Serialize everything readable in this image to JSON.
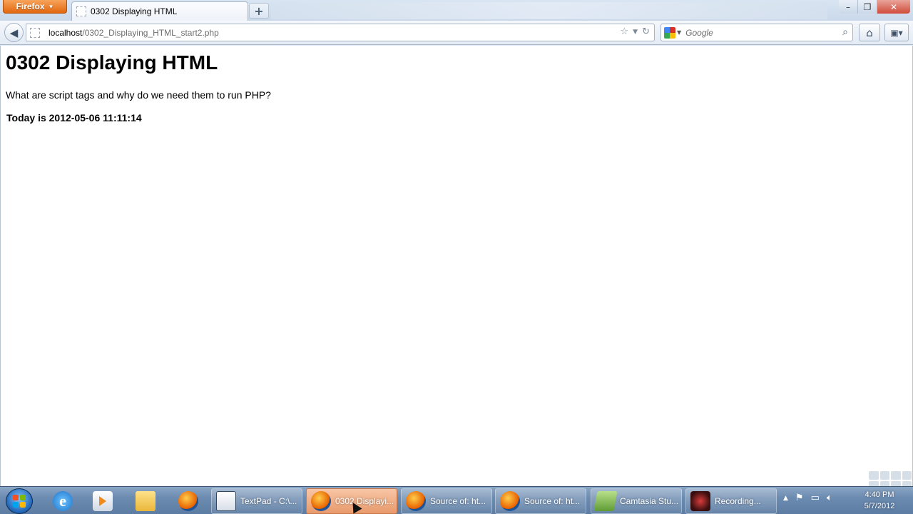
{
  "browser": {
    "menu_label": "Firefox",
    "tab": {
      "title": "0302 Displaying HTML"
    },
    "new_tab_label": "+",
    "window_controls": {
      "minimize": "–",
      "maximize": "❐",
      "close": "✕"
    },
    "url": {
      "host": "localhost",
      "path": "/0302_Displaying_HTML_start2.php"
    },
    "search": {
      "placeholder": "Google",
      "value": ""
    },
    "icons": [
      "back-arrow-icon",
      "bookmark-star-icon",
      "history-dropdown-icon",
      "reload-icon",
      "search-icon",
      "home-icon",
      "addon-icon"
    ]
  },
  "page": {
    "heading": "0302 Displaying HTML",
    "paragraph": "What are script tags and why do we need them to run PHP?",
    "date_line": "Today is 2012-05-06 11:11:14"
  },
  "taskbar": {
    "pinned": [
      "Internet Explorer",
      "Windows Media Player",
      "Windows Explorer",
      "Firefox"
    ],
    "tasks": [
      {
        "label": "TextPad - C:\\...",
        "active": false
      },
      {
        "label": "0302 Displayi...",
        "active": true
      },
      {
        "label": "Source of: ht...",
        "active": false
      },
      {
        "label": "Source of: ht...",
        "active": false
      },
      {
        "label": "Camtasia Stu...",
        "active": false
      },
      {
        "label": "Recording...",
        "active": false
      }
    ],
    "clock": {
      "time": "4:40 PM",
      "date": "5/7/2012"
    }
  },
  "colors": {
    "firefox_orange": "#e66000",
    "active_task": "#e89a6c",
    "taskbar_blue": "#6c8bb0"
  }
}
